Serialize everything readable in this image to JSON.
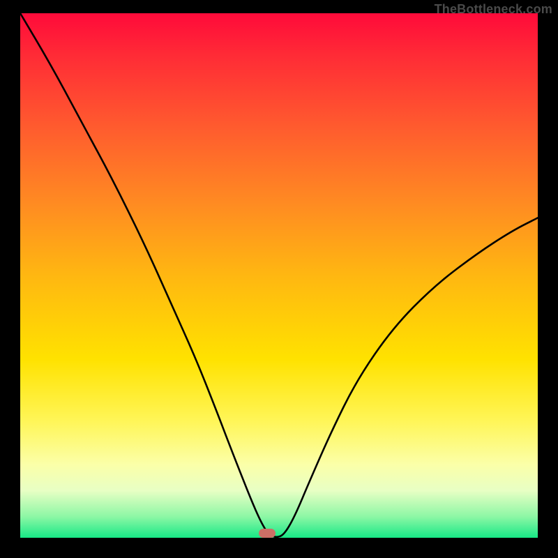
{
  "watermark": "TheBottleneck.com",
  "marker": {
    "x_frac": 0.477,
    "y_frac": 0.992
  },
  "chart_data": {
    "type": "line",
    "title": "",
    "xlabel": "",
    "ylabel": "",
    "xlim": [
      0,
      1
    ],
    "ylim": [
      0,
      1
    ],
    "series": [
      {
        "name": "bottleneck-curve",
        "x": [
          0.0,
          0.06,
          0.12,
          0.18,
          0.24,
          0.29,
          0.34,
          0.38,
          0.415,
          0.445,
          0.465,
          0.48,
          0.495,
          0.51,
          0.53,
          0.56,
          0.6,
          0.65,
          0.72,
          0.8,
          0.88,
          0.95,
          1.0
        ],
        "y": [
          1.0,
          0.9,
          0.79,
          0.68,
          0.56,
          0.45,
          0.34,
          0.24,
          0.15,
          0.075,
          0.03,
          0.006,
          0.0,
          0.006,
          0.04,
          0.11,
          0.2,
          0.3,
          0.4,
          0.48,
          0.54,
          0.585,
          0.61
        ]
      }
    ],
    "gradient_stops": [
      {
        "pos": 0.0,
        "color": "#ff0a3a"
      },
      {
        "pos": 0.08,
        "color": "#ff2b36"
      },
      {
        "pos": 0.22,
        "color": "#ff5c2e"
      },
      {
        "pos": 0.36,
        "color": "#ff8a22"
      },
      {
        "pos": 0.5,
        "color": "#ffb711"
      },
      {
        "pos": 0.66,
        "color": "#ffe200"
      },
      {
        "pos": 0.78,
        "color": "#fff65a"
      },
      {
        "pos": 0.86,
        "color": "#fbffa8"
      },
      {
        "pos": 0.91,
        "color": "#e8ffc4"
      },
      {
        "pos": 0.96,
        "color": "#8cf7a5"
      },
      {
        "pos": 1.0,
        "color": "#17e886"
      }
    ]
  }
}
